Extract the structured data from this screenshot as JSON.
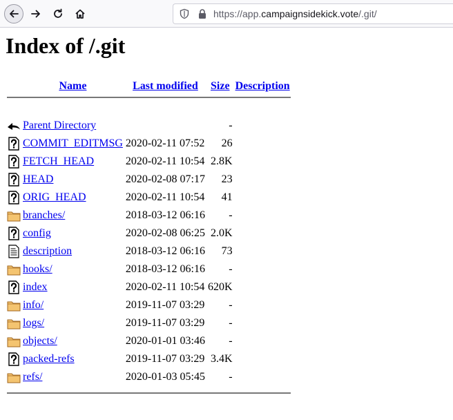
{
  "browser": {
    "url_prefix": "https://app.",
    "url_host": "campaignsidekick.vote",
    "url_path": "/.git/"
  },
  "page": {
    "title": "Index of /.git"
  },
  "table": {
    "headers": {
      "name": "Name",
      "modified": "Last modified",
      "size": "Size",
      "description": "Description"
    },
    "parent": {
      "label": "Parent Directory",
      "size": "-",
      "icon": "back-arrow-icon"
    },
    "rows": [
      {
        "name": "COMMIT_EDITMSG",
        "modified": "2020-02-11 07:52",
        "size": "26",
        "icon": "unknown-file-icon"
      },
      {
        "name": "FETCH_HEAD",
        "modified": "2020-02-11 10:54",
        "size": "2.8K",
        "icon": "unknown-file-icon"
      },
      {
        "name": "HEAD",
        "modified": "2020-02-08 07:17",
        "size": "23",
        "icon": "unknown-file-icon"
      },
      {
        "name": "ORIG_HEAD",
        "modified": "2020-02-11 10:54",
        "size": "41",
        "icon": "unknown-file-icon"
      },
      {
        "name": "branches/",
        "modified": "2018-03-12 06:16",
        "size": "-",
        "icon": "folder-icon"
      },
      {
        "name": "config",
        "modified": "2020-02-08 06:25",
        "size": "2.0K",
        "icon": "unknown-file-icon"
      },
      {
        "name": "description",
        "modified": "2018-03-12 06:16",
        "size": "73",
        "icon": "text-file-icon"
      },
      {
        "name": "hooks/",
        "modified": "2018-03-12 06:16",
        "size": "-",
        "icon": "folder-icon"
      },
      {
        "name": "index",
        "modified": "2020-02-11 10:54",
        "size": "620K",
        "icon": "unknown-file-icon"
      },
      {
        "name": "info/",
        "modified": "2019-11-07 03:29",
        "size": "-",
        "icon": "folder-icon"
      },
      {
        "name": "logs/",
        "modified": "2019-11-07 03:29",
        "size": "-",
        "icon": "folder-icon"
      },
      {
        "name": "objects/",
        "modified": "2020-01-01 03:46",
        "size": "-",
        "icon": "folder-icon"
      },
      {
        "name": "packed-refs",
        "modified": "2019-11-07 03:29",
        "size": "3.4K",
        "icon": "unknown-file-icon"
      },
      {
        "name": "refs/",
        "modified": "2020-01-03 05:45",
        "size": "-",
        "icon": "folder-icon"
      }
    ]
  },
  "colors": {
    "link": "#0000ee",
    "folder_fill": "#f4c470",
    "folder_stroke": "#a0661e"
  }
}
